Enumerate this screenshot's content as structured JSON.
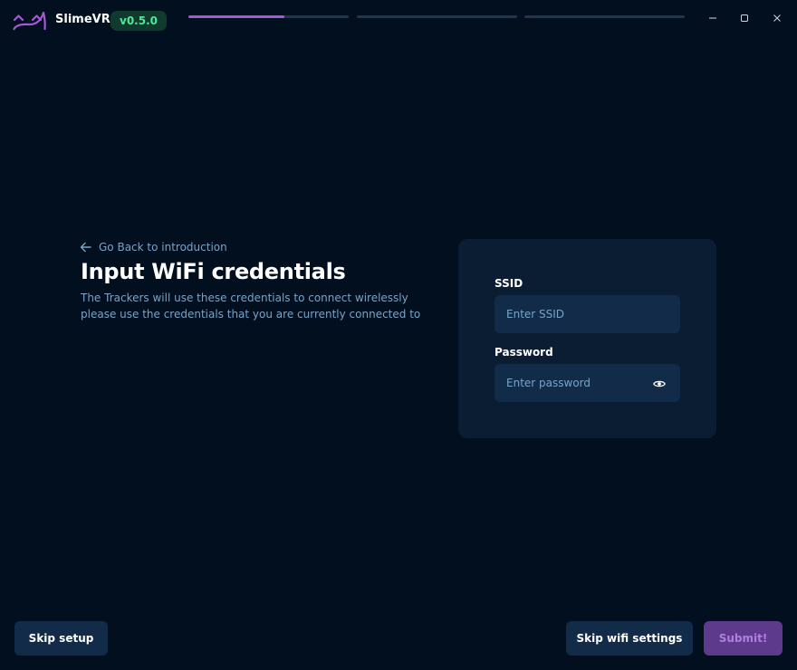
{
  "app": {
    "name": "SlimeVR",
    "version": "v0.5.0",
    "logo_icon": "slimevr-logo-icon"
  },
  "progress": {
    "steps": [
      {
        "fill_fraction": 0.6
      },
      {
        "fill_fraction": 0.0
      },
      {
        "fill_fraction": 0.0
      }
    ],
    "accent_color": "#a45ad4"
  },
  "window_controls": {
    "minimize_icon": "minimize-icon",
    "maximize_icon": "maximize-icon",
    "close_icon": "close-icon"
  },
  "header": {
    "back_label": "Go Back to introduction",
    "back_icon": "arrow-left-icon",
    "title": "Input WiFi credentials",
    "description_line1": "The Trackers will use these credentials to connect wirelessly",
    "description_line2": "please use the credentials that you are currently connected to"
  },
  "form": {
    "ssid": {
      "label": "SSID",
      "placeholder": "Enter SSID",
      "value": ""
    },
    "password": {
      "label": "Password",
      "placeholder": "Enter password",
      "value": "",
      "toggle_icon": "eye-icon"
    }
  },
  "footer": {
    "skip_setup_label": "Skip setup",
    "skip_wifi_label": "Skip wifi settings",
    "submit_label": "Submit!"
  },
  "colors": {
    "background": "#020f1e",
    "card": "#0a1d33",
    "input": "#112b48",
    "accent": "#a45ad4",
    "version_text": "#50e897",
    "muted_text": "#78a4c8"
  }
}
